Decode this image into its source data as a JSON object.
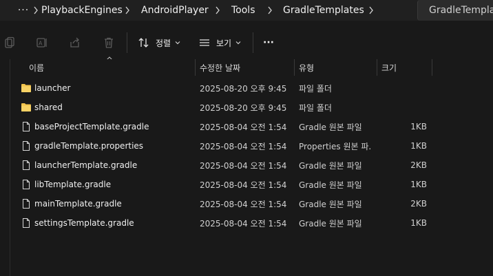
{
  "breadcrumb": {
    "more_label": "···",
    "items": [
      "PlaybackEngines",
      "AndroidPlayer",
      "Tools",
      "GradleTemplates"
    ]
  },
  "search": {
    "text": "GradleTemplat"
  },
  "toolbar": {
    "sort_label": "정렬",
    "view_label": "보기",
    "more_label": "···"
  },
  "columns": {
    "name": "이름",
    "modified": "수정한 날짜",
    "type": "유형",
    "size": "크기"
  },
  "colors": {
    "folder": "#f3c44c",
    "background": "#191919",
    "header_bar": "#202020"
  },
  "files": [
    {
      "icon": "folder-icon",
      "name": "launcher",
      "modified": "2025-08-20 오후 9:45",
      "type": "파일 폴더",
      "size": ""
    },
    {
      "icon": "folder-icon",
      "name": "shared",
      "modified": "2025-08-20 오후 9:45",
      "type": "파일 폴더",
      "size": ""
    },
    {
      "icon": "file-icon",
      "name": "baseProjectTemplate.gradle",
      "modified": "2025-08-04 오전 1:54",
      "type": "Gradle 원본 파일",
      "size": "1KB"
    },
    {
      "icon": "file-icon",
      "name": "gradleTemplate.properties",
      "modified": "2025-08-04 오전 1:54",
      "type": "Properties 원본 파...",
      "size": "1KB"
    },
    {
      "icon": "file-icon",
      "name": "launcherTemplate.gradle",
      "modified": "2025-08-04 오전 1:54",
      "type": "Gradle 원본 파일",
      "size": "2KB"
    },
    {
      "icon": "file-icon",
      "name": "libTemplate.gradle",
      "modified": "2025-08-04 오전 1:54",
      "type": "Gradle 원본 파일",
      "size": "1KB"
    },
    {
      "icon": "file-icon",
      "name": "mainTemplate.gradle",
      "modified": "2025-08-04 오전 1:54",
      "type": "Gradle 원본 파일",
      "size": "2KB"
    },
    {
      "icon": "file-icon",
      "name": "settingsTemplate.gradle",
      "modified": "2025-08-04 오전 1:54",
      "type": "Gradle 원본 파일",
      "size": "1KB"
    }
  ]
}
